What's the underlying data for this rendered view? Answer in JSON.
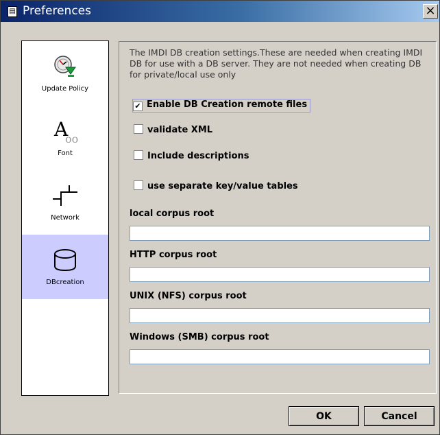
{
  "window": {
    "title": "Preferences",
    "close_label": "×"
  },
  "sidebar": {
    "items": [
      {
        "label": "Update Policy",
        "icon": "update-policy-icon",
        "selected": false
      },
      {
        "label": "Font",
        "icon": "font-icon",
        "selected": false
      },
      {
        "label": "Network",
        "icon": "network-icon",
        "selected": false
      },
      {
        "label": "DBcreation",
        "icon": "database-icon",
        "selected": true
      }
    ]
  },
  "panel": {
    "description": "The IMDI DB creation settings.These are needed when creating IMDI DB for use with a DB server.  They are not needed when creating DB for private/local use only",
    "checkboxes": [
      {
        "label": "Enable DB Creation remote files",
        "checked": true
      },
      {
        "label": "validate XML",
        "checked": false
      },
      {
        "label": "Include descriptions",
        "checked": false
      },
      {
        "label": "use separate key/value tables",
        "checked": false
      }
    ],
    "fields": [
      {
        "label": "local corpus root",
        "value": ""
      },
      {
        "label": "HTTP corpus root",
        "value": ""
      },
      {
        "label": "UNIX (NFS) corpus root",
        "value": ""
      },
      {
        "label": "Windows (SMB) corpus root",
        "value": ""
      }
    ]
  },
  "buttons": {
    "ok": "OK",
    "cancel": "Cancel"
  },
  "colors": {
    "titlebar_start": "#0a246a",
    "titlebar_end": "#a6caf0",
    "selected_item": "#ccccff",
    "dialog_bg": "#d4d0c8"
  }
}
